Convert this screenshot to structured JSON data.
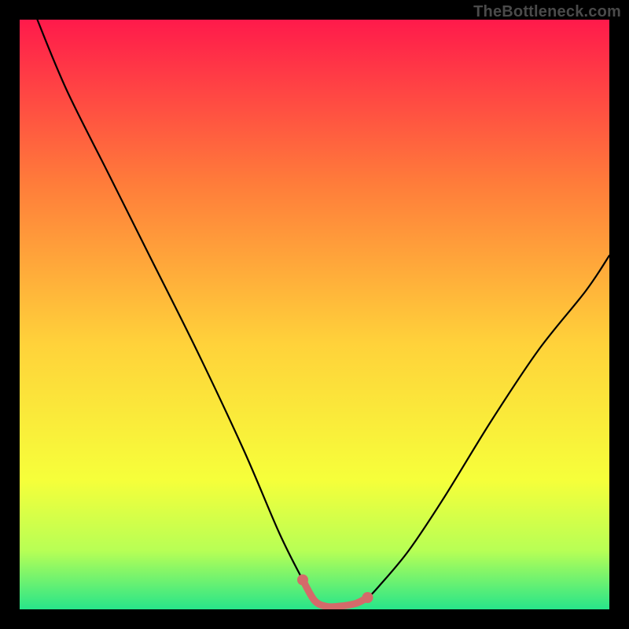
{
  "watermark": "TheBottleneck.com",
  "colors": {
    "frame": "#000000",
    "watermark_text": "#4a4a4a",
    "gradient_top": "#ff1a4b",
    "gradient_mid_upper": "#ff7d3a",
    "gradient_mid": "#ffd23a",
    "gradient_mid_lower": "#f6ff3a",
    "gradient_low": "#b8ff55",
    "gradient_bottom": "#27e58a",
    "curve": "#000000",
    "marker_stroke": "#d46a6a",
    "marker_fill": "#d46a6a"
  },
  "chart_data": {
    "type": "line",
    "title": "",
    "xlabel": "",
    "ylabel": "",
    "xlim": [
      0,
      100
    ],
    "ylim": [
      0,
      100
    ],
    "grid": false,
    "legend": false,
    "series": [
      {
        "name": "bottleneck-curve",
        "x": [
          0,
          3,
          8,
          15,
          22,
          30,
          38,
          44,
          48,
          50,
          52,
          54,
          57,
          59,
          61,
          66,
          72,
          80,
          88,
          96,
          100
        ],
        "y": [
          108,
          100,
          88,
          74,
          60,
          44,
          27,
          13,
          5,
          1.5,
          0.5,
          0.5,
          1,
          2,
          4,
          10,
          19,
          32,
          44,
          54,
          60
        ]
      }
    ],
    "highlight_segment": {
      "name": "optimal-range",
      "x": [
        48,
        50,
        52,
        54,
        57,
        59
      ],
      "y": [
        5,
        1.5,
        0.5,
        0.5,
        1,
        2
      ]
    }
  }
}
